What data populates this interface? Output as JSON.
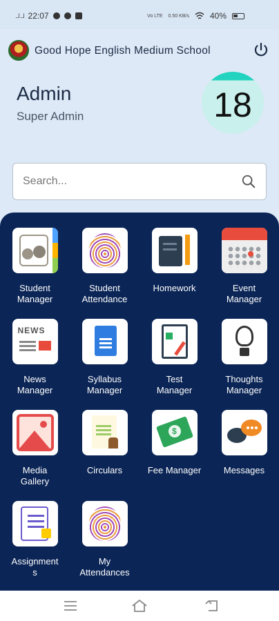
{
  "status_bar": {
    "time": "22:07",
    "signal_left": "...l ...l",
    "net_labels": [
      "Vo LTE",
      "0.50 KB/s"
    ],
    "battery": "40%"
  },
  "header": {
    "school_name": "Good Hope English Medium School",
    "logo_icon": "school-crest-icon",
    "power_icon": "power-icon"
  },
  "profile": {
    "name": "Admin",
    "role": "Super Admin",
    "count": "18"
  },
  "search": {
    "placeholder": "Search...",
    "value": ""
  },
  "menu": [
    {
      "label": "Student\nManager",
      "icon": "contacts-book-icon"
    },
    {
      "label": "Student\nAttendance",
      "icon": "fingerprint-icon"
    },
    {
      "label": "Homework",
      "icon": "notebook-pencil-icon"
    },
    {
      "label": "Event\nManager",
      "icon": "calendar-icon"
    },
    {
      "label": "News\nManager",
      "icon": "newspaper-icon"
    },
    {
      "label": "Syllabus\nManager",
      "icon": "document-icon"
    },
    {
      "label": "Test\nManager",
      "icon": "clipboard-icon"
    },
    {
      "label": "Thoughts\nManager",
      "icon": "lightbulb-icon"
    },
    {
      "label": "Media\nGallery",
      "icon": "image-gallery-icon"
    },
    {
      "label": "Circulars",
      "icon": "certificate-icon"
    },
    {
      "label": "Fee Manager",
      "icon": "money-icon"
    },
    {
      "label": "Messages",
      "icon": "chat-bubbles-icon"
    },
    {
      "label": "Assignment\ns",
      "icon": "checklist-icon"
    },
    {
      "label": "My\nAttendances",
      "icon": "fingerprint-icon"
    }
  ],
  "nav_bar": {
    "icons": [
      "menu-icon",
      "home-icon",
      "back-icon"
    ]
  },
  "colors": {
    "background": "#dde9f6",
    "panel": "#0b2556",
    "accent_teal": "#22d3c0"
  }
}
